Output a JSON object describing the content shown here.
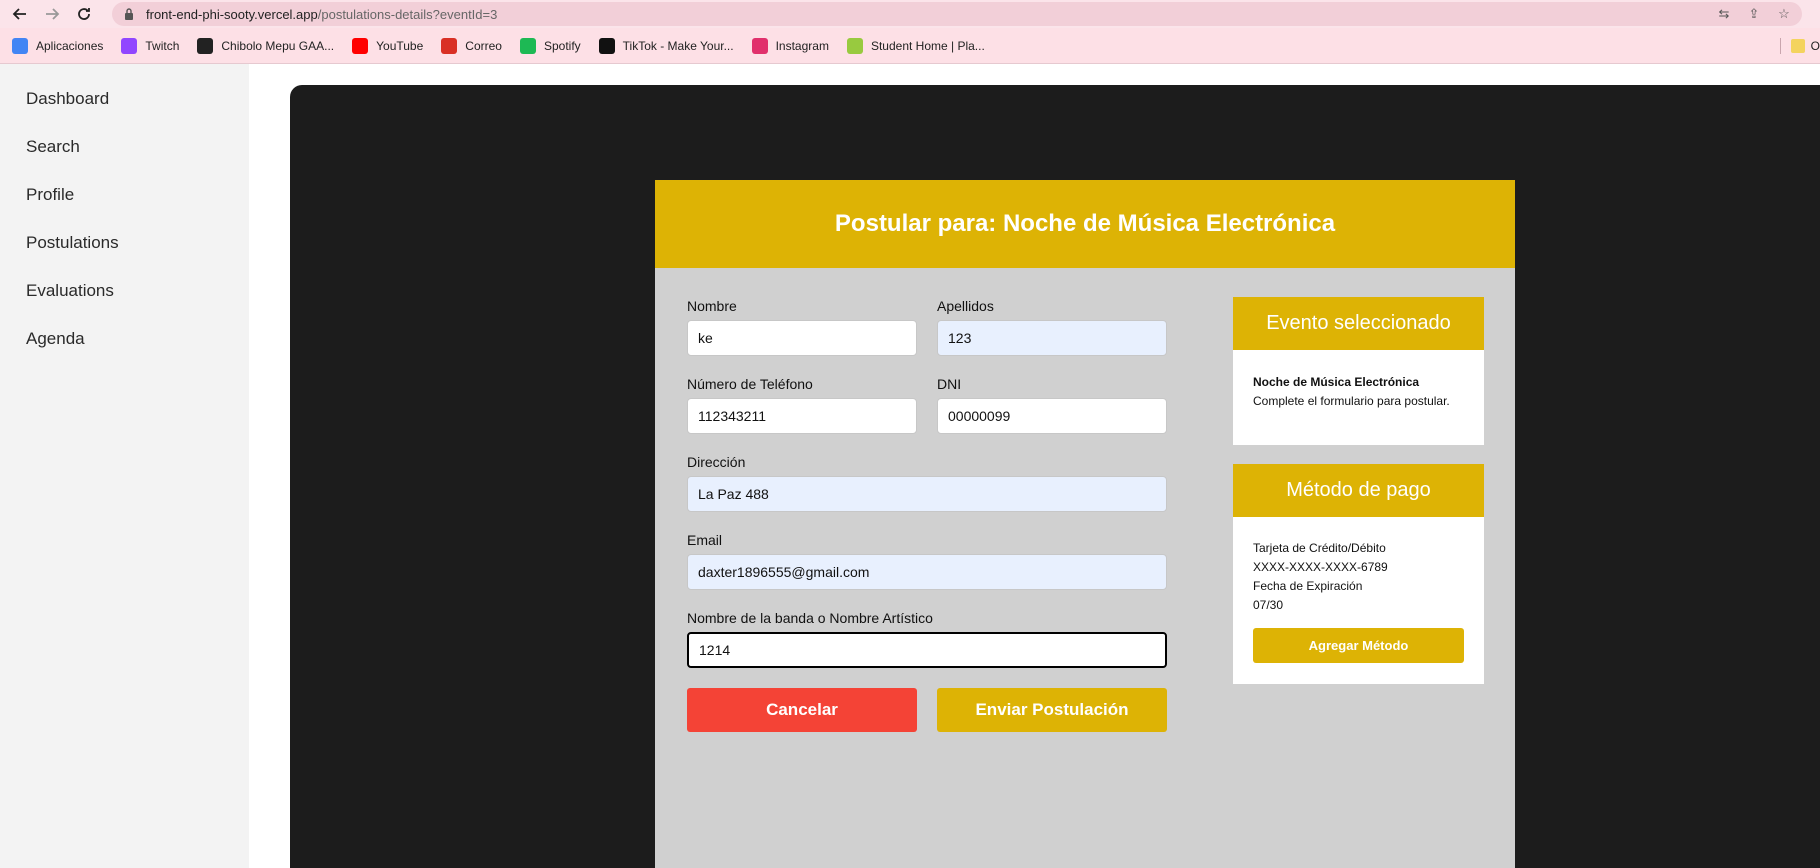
{
  "browser": {
    "url_host": "front-end-phi-sooty.vercel.app",
    "url_path": "/postulations-details?eventId=3",
    "bookmarks": [
      {
        "label": "Aplicaciones",
        "icon": "apps-grid-icon",
        "color": "#4285f4"
      },
      {
        "label": "Twitch",
        "icon": "twitch-icon",
        "color": "#9146ff"
      },
      {
        "label": "Chibolo Mepu GAA...",
        "icon": "af-icon",
        "color": "#222222"
      },
      {
        "label": "YouTube",
        "icon": "youtube-icon",
        "color": "#ff0000"
      },
      {
        "label": "Correo",
        "icon": "gmail-icon",
        "color": "#d93025"
      },
      {
        "label": "Spotify",
        "icon": "spotify-icon",
        "color": "#1db954"
      },
      {
        "label": "TikTok - Make Your...",
        "icon": "tiktok-icon",
        "color": "#111111"
      },
      {
        "label": "Instagram",
        "icon": "instagram-icon",
        "color": "#e1306c"
      },
      {
        "label": "Student Home | Pla...",
        "icon": "platzi-icon",
        "color": "#98ca3f"
      }
    ],
    "bookmark_overflow": "O"
  },
  "sidebar": {
    "items": [
      {
        "label": "Dashboard"
      },
      {
        "label": "Search"
      },
      {
        "label": "Profile"
      },
      {
        "label": "Postulations"
      },
      {
        "label": "Evaluations"
      },
      {
        "label": "Agenda"
      }
    ]
  },
  "form": {
    "title": "Postular para: Noche de Música Electrónica",
    "nombre_label": "Nombre",
    "nombre_value": "ke",
    "apellidos_label": "Apellidos",
    "apellidos_value": "123",
    "telefono_label": "Número de Teléfono",
    "telefono_value": "112343211",
    "dni_label": "DNI",
    "dni_value": "00000099",
    "direccion_label": "Dirección",
    "direccion_value": "La Paz 488",
    "email_label": "Email",
    "email_value": "daxter1896555@gmail.com",
    "banda_label": "Nombre de la banda o Nombre Artístico",
    "banda_value": "1214",
    "cancel_label": "Cancelar",
    "submit_label": "Enviar Postulación"
  },
  "event_panel": {
    "title": "Evento seleccionado",
    "event_name": "Noche de Música Electrónica",
    "description": "Complete el formulario para postular."
  },
  "payment_panel": {
    "title": "Método de pago",
    "card_type": "Tarjeta de Crédito/Débito",
    "card_number": "XXXX-XXXX-XXXX-6789",
    "expiry_label": "Fecha de Expiración",
    "expiry_value": "07/30",
    "add_label": "Agregar Método"
  },
  "colors": {
    "accent": "#ddb305",
    "cancel": "#f44336",
    "stage": "#1c1c1c",
    "card": "#d0d0d0"
  }
}
